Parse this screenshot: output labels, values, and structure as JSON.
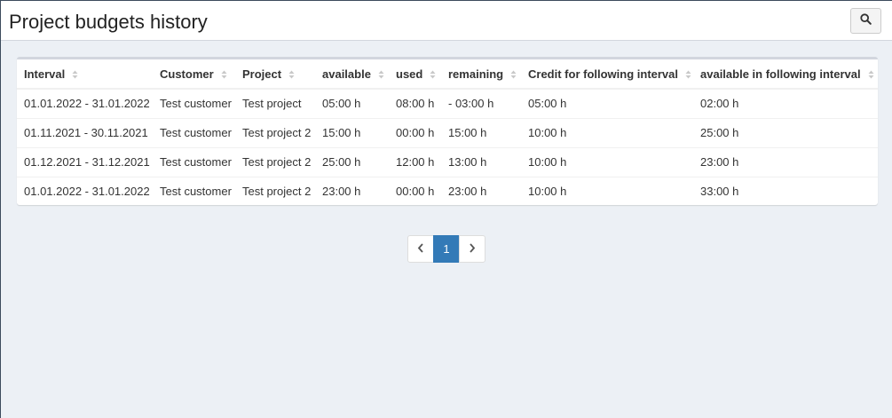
{
  "header": {
    "title": "Project budgets history",
    "search_icon": "search-icon"
  },
  "table": {
    "columns": [
      "Interval",
      "Customer",
      "Project",
      "available",
      "used",
      "remaining",
      "Credit for following interval",
      "available in following interval"
    ],
    "rows": [
      [
        "01.01.2022 - 31.01.2022",
        "Test customer",
        "Test project",
        "05:00 h",
        "08:00 h",
        "- 03:00 h",
        "05:00 h",
        "02:00 h"
      ],
      [
        "01.11.2021 - 30.11.2021",
        "Test customer",
        "Test project 2",
        "15:00 h",
        "00:00 h",
        "15:00 h",
        "10:00 h",
        "25:00 h"
      ],
      [
        "01.12.2021 - 31.12.2021",
        "Test customer",
        "Test project 2",
        "25:00 h",
        "12:00 h",
        "13:00 h",
        "10:00 h",
        "23:00 h"
      ],
      [
        "01.01.2022 - 31.01.2022",
        "Test customer",
        "Test project 2",
        "23:00 h",
        "00:00 h",
        "23:00 h",
        "10:00 h",
        "33:00 h"
      ]
    ]
  },
  "pagination": {
    "current": "1",
    "prev_icon": "chevron-left-icon",
    "next_icon": "chevron-right-icon"
  },
  "colors": {
    "accent": "#337ab7",
    "background": "#ecf0f5"
  }
}
